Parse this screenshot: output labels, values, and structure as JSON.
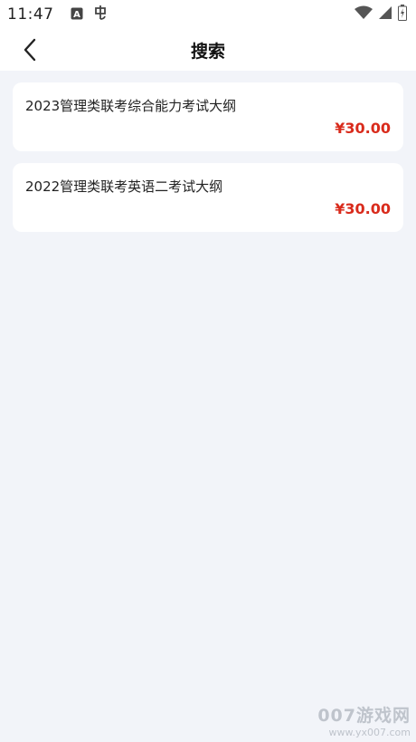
{
  "status_bar": {
    "time": "11:47",
    "icons": [
      "font-icon",
      "bug-icon",
      "wifi-icon",
      "signal-icon",
      "battery-icon"
    ]
  },
  "header": {
    "back_icon": "back-arrow-icon",
    "title": "搜索"
  },
  "results": [
    {
      "name": "2023管理类联考综合能力考试大纲",
      "price": "¥30.00"
    },
    {
      "name": "2022管理类联考英语二考试大纲",
      "price": "¥30.00"
    }
  ],
  "colors": {
    "background": "#f2f4f9",
    "card": "#ffffff",
    "price": "#d92b1c"
  },
  "watermark": {
    "brand": "007游戏网",
    "url": "www.yx007.com"
  }
}
